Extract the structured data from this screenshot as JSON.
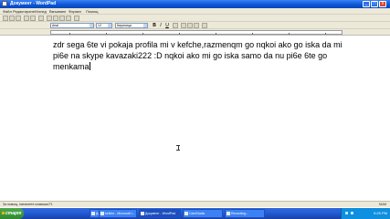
{
  "window": {
    "title": "Документ - WordPad",
    "min_label": "_",
    "max_label": "□",
    "close_label": "x"
  },
  "menu": {
    "items": [
      "Файл",
      "Редактиране",
      "Изглед",
      "Вмъкване",
      "Формат",
      "Помощ"
    ]
  },
  "format_bar": {
    "font": "Arial",
    "size": "12",
    "script": "Кирилица",
    "bold": "B",
    "italic": "I",
    "underline": "U"
  },
  "document": {
    "text": "zdr sega 6te vi pokaja profila mi v kefche,razmenqm go nqkoi ako go iska da mi pi6e na skype kavazaki222 :D nqkoi ako mi go iska samo da nu pi6e 6te go menkama"
  },
  "statusbar": {
    "text": "За помощ, натиснете клавиша F1",
    "right": "NUM"
  },
  "taskbar": {
    "start_label": "старт",
    "tasks": [
      {
        "label": "Документ - WordPad"
      },
      {
        "label": "kefche - Microsoft I..."
      },
      {
        "label": "Документ - WordPad"
      },
      {
        "label": "CamStudio"
      },
      {
        "label": "Recording..."
      }
    ],
    "clock": "9:25 PM"
  }
}
